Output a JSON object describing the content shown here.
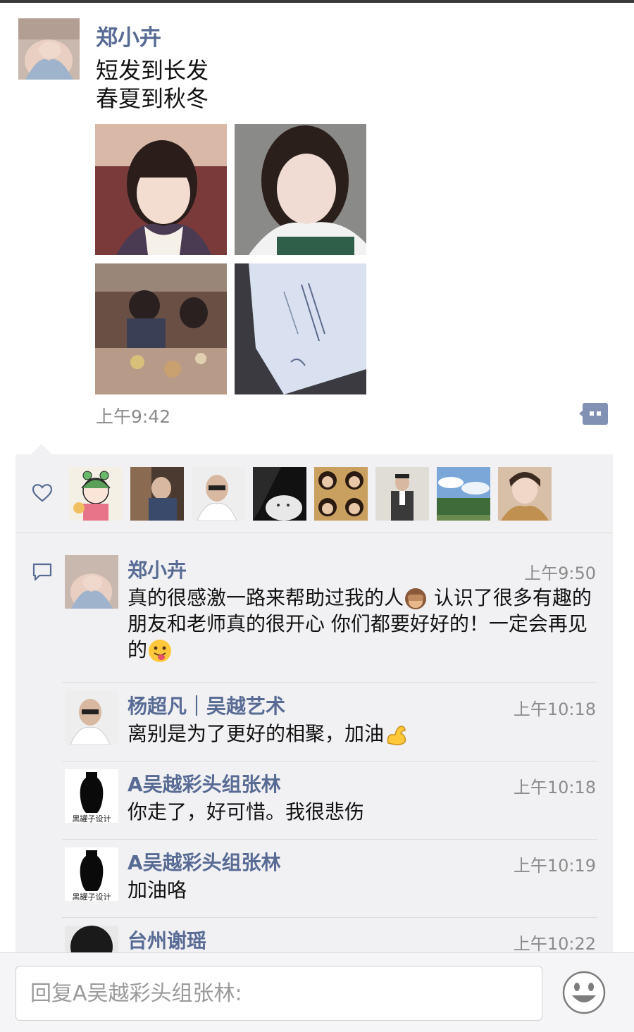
{
  "post": {
    "author": "郑小卉",
    "text_line1": "短发到长发",
    "text_line2": "春夏到秋冬",
    "time": "上午9:42"
  },
  "likes": {
    "icon": "heart-icon",
    "count_shown": 8
  },
  "comments": [
    {
      "name": "郑小卉",
      "time": "上午9:50",
      "text": "真的很感激一路来帮助过我的人",
      "text2": " 认识了很多有趣的朋友和老师真的很开心 你们都要好好的！一定会再见的"
    },
    {
      "name": "杨超凡｜吴越艺术",
      "time": "上午10:18",
      "text": "离别是为了更好的相聚，加油"
    },
    {
      "name": "A吴越彩头组张林",
      "time": "上午10:18",
      "text": "你走了，好可惜。我很悲伤",
      "avatar_caption": "黑罐子设计"
    },
    {
      "name": "A吴越彩头组张林",
      "time": "上午10:19",
      "text": "加油咯",
      "avatar_caption": "黑罐子设计"
    },
    {
      "name": "台州谢瑶",
      "time": "上午10:22",
      "text": ""
    }
  ],
  "reply": {
    "placeholder": "回复A吴越彩头组张林:"
  },
  "colors": {
    "name_link": "#576b95",
    "panel_bg": "#f1f1f3",
    "time_gray": "#8b8b8b"
  }
}
